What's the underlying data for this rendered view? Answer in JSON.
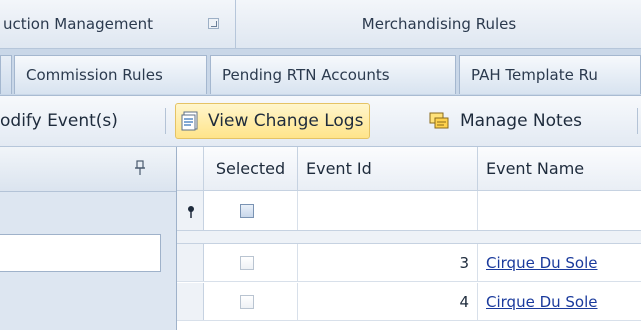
{
  "ribbon": {
    "groups": [
      {
        "label": "uction Management"
      },
      {
        "label": "Merchandising Rules"
      }
    ]
  },
  "tabs": [
    {
      "label": ""
    },
    {
      "label": "Commission Rules"
    },
    {
      "label": "Pending RTN Accounts"
    },
    {
      "label": "PAH Template Ru"
    }
  ],
  "toolbar": {
    "modify_label": "odify Event(s)",
    "view_change_logs_label": "View Change Logs",
    "manage_notes_label": "Manage Notes"
  },
  "grid": {
    "columns": [
      "Selected",
      "Event Id",
      "Event Name"
    ],
    "rows": [
      {
        "event_id": "3",
        "event_name": "Cirque Du Sole"
      },
      {
        "event_id": "4",
        "event_name": "Cirque Du Sole"
      }
    ]
  },
  "colors": {
    "accent": "#ffe48a",
    "link": "#1a3a9c",
    "panel": "#dde6f1"
  }
}
